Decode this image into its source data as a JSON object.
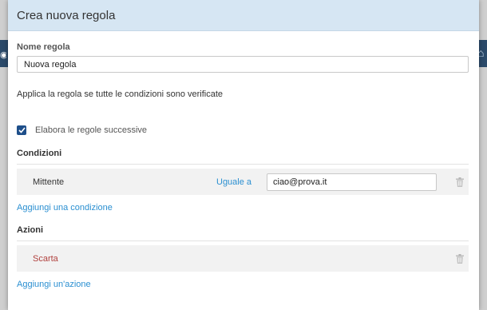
{
  "modal": {
    "title": "Crea nuova regola",
    "name_label": "Nome regola",
    "name_value": "Nuova regola",
    "apply_text": "Applica la regola se tutte le condizioni sono verificate",
    "checkbox_label": "Elabora le regole successive",
    "checkbox_checked": true
  },
  "conditions": {
    "title": "Condizioni",
    "rows": [
      {
        "field": "Mittente",
        "operator": "Uguale a",
        "value": "ciao@prova.it"
      }
    ],
    "add_link": "Aggiungi una condizione"
  },
  "actions": {
    "title": "Azioni",
    "rows": [
      {
        "label": "Scarta"
      }
    ],
    "add_link": "Aggiungi un'azione"
  },
  "colors": {
    "header_bg": "#d6e6f3",
    "link": "#2a8fd1",
    "action_text": "#b0413e",
    "checkbox": "#1e4f8a"
  }
}
